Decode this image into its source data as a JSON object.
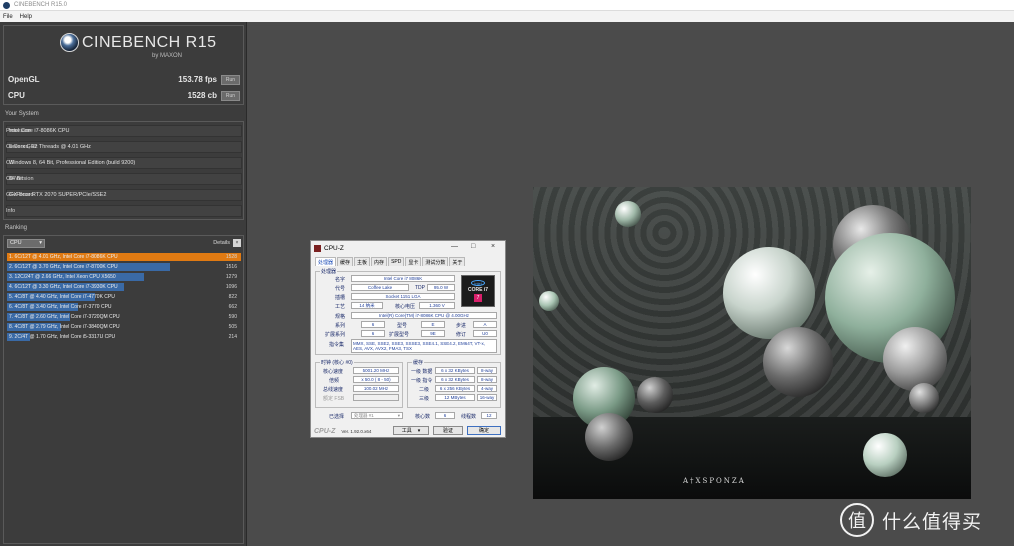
{
  "window": {
    "title": "CINEBENCH R15.0"
  },
  "menu": {
    "items": [
      "File",
      "Help"
    ]
  },
  "logo": {
    "name": "CINEBENCH R15",
    "sub": "by MAXON"
  },
  "scores": {
    "opengl": {
      "label": "OpenGL",
      "value": "153.78 fps",
      "run": "Run"
    },
    "cpu": {
      "label": "CPU",
      "value": "1528 cb",
      "run": "Run"
    }
  },
  "system": {
    "heading": "Your System",
    "rows": [
      {
        "k": "Processor",
        "v": "Intel Core i7-8086K CPU"
      },
      {
        "k": "Cores x GHz",
        "v": "6 Cores, 12 Threads @ 4.01 GHz"
      },
      {
        "k": "OS",
        "v": "Windows 8, 64 Bit, Professional Edition (build 9200)"
      },
      {
        "k": "CB Version",
        "v": "64 Bit"
      },
      {
        "k": "GFX Board",
        "v": "GeForce RTX 2070 SUPER/PCIe/SSE2"
      },
      {
        "k": "Info",
        "v": ""
      }
    ]
  },
  "ranking": {
    "heading": "Ranking",
    "select": "CPU",
    "details": "Details",
    "rows": [
      {
        "label": "1. 6C/12T @ 4.01 GHz, Intel Core i7-8086K CPU",
        "score": 1528
      },
      {
        "label": "2. 6C/12T @ 3.70 GHz, Intel Core i7-8700K CPU",
        "score": 1516
      },
      {
        "label": "3. 12C/24T @ 2.66 GHz, Intel Xeon CPU X5650",
        "score": 1279
      },
      {
        "label": "4. 6C/12T @ 3.30 GHz, Intel Core i7-3930K CPU",
        "score": 1096
      },
      {
        "label": "5. 4C/8T @ 4.40 GHz, Intel Core i7-4770K CPU",
        "score": 822
      },
      {
        "label": "6. 4C/8T @ 3.40 GHz, Intel Core i7-3770 CPU",
        "score": 662
      },
      {
        "label": "7. 4C/8T @ 2.60 GHz, Intel Core i7-3720QM CPU",
        "score": 590
      },
      {
        "label": "8. 4C/8T @ 2.79 GHz, Intel Core i7-3840QM CPU",
        "score": 505
      },
      {
        "label": "9. 2C/4T @ 1.70 GHz, Intel Core i5-3317U CPU",
        "score": 214
      }
    ]
  },
  "cpuz": {
    "title": "CPU-Z",
    "tabs": [
      "处理器",
      "缓存",
      "主板",
      "内存",
      "SPD",
      "显卡",
      "测试分数",
      "关于"
    ],
    "processor_group": "处理器",
    "name_k": "名字",
    "name_v": "Intel Core i7 8086K",
    "code_k": "代号",
    "code_v": "Coffee Lake",
    "tdp_k": "TDP",
    "tdp_v": "95.0 W",
    "pkg_k": "插槽",
    "pkg_v": "Socket 1151 LGA",
    "tech_k": "工艺",
    "tech_v": "14 纳米",
    "volt_k": "核心电压",
    "volt_v": "1.360 V",
    "spec_k": "规格",
    "spec_v": "Intel(R) Core(TM) i7-8086K CPU @ 4.00GHz",
    "fam_k": "系列",
    "fam_v": "6",
    "model_k": "型号",
    "model_v": "E",
    "step_k": "步进",
    "step_v": "A",
    "efam_k": "扩展系列",
    "efam_v": "6",
    "emodel_k": "扩展型号",
    "emodel_v": "9E",
    "rev_k": "修订",
    "rev_v": "U0",
    "inst_k": "指令集",
    "inst_v1": "MMX, SSE, SSE2, SSE3, SSSE3, SSE4.1, SSE4.2, EM64T, VT-x,",
    "inst_v2": "AES, AVX, AVX2, FMA3, TSX",
    "clock_group": "时钟 (核心 #0)",
    "core_k": "核心速度",
    "core_v": "5001.20 MHz",
    "mult_k": "倍频",
    "mult_v": "x 50.0 ( 8 - 50)",
    "bus_k": "总线速度",
    "bus_v": "100.02 MHz",
    "fsb_k": "额定 FSB",
    "fsb_v": "",
    "cache_group": "缓存",
    "l1d_k": "一级 数据",
    "l1d_v": "6 x 32 KBytes",
    "l1d_w": "8-way",
    "l1i_k": "一级 指令",
    "l1i_v": "6 x 32 KBytes",
    "l1i_w": "8-way",
    "l2_k": "二级",
    "l2_v": "6 x 256 KBytes",
    "l2_w": "4-way",
    "l3_k": "三级",
    "l3_v": "12 MBytes",
    "l3_w": "16-way",
    "sel_k": "已选择",
    "sel_v": "处理器 #1",
    "cores_k": "核心数",
    "cores_v": "6",
    "threads_k": "线程数",
    "threads_v": "12",
    "brand": "CPU-Z",
    "version": "Ver. 1.92.0.x64",
    "tools": "工具",
    "validate": "验证",
    "ok": "确定",
    "intel_brand": "intel",
    "intel_model": "CORE i7"
  },
  "render": {
    "logo": "A†XSPONZA"
  },
  "watermark": {
    "circle": "值",
    "text": "什么值得买"
  }
}
